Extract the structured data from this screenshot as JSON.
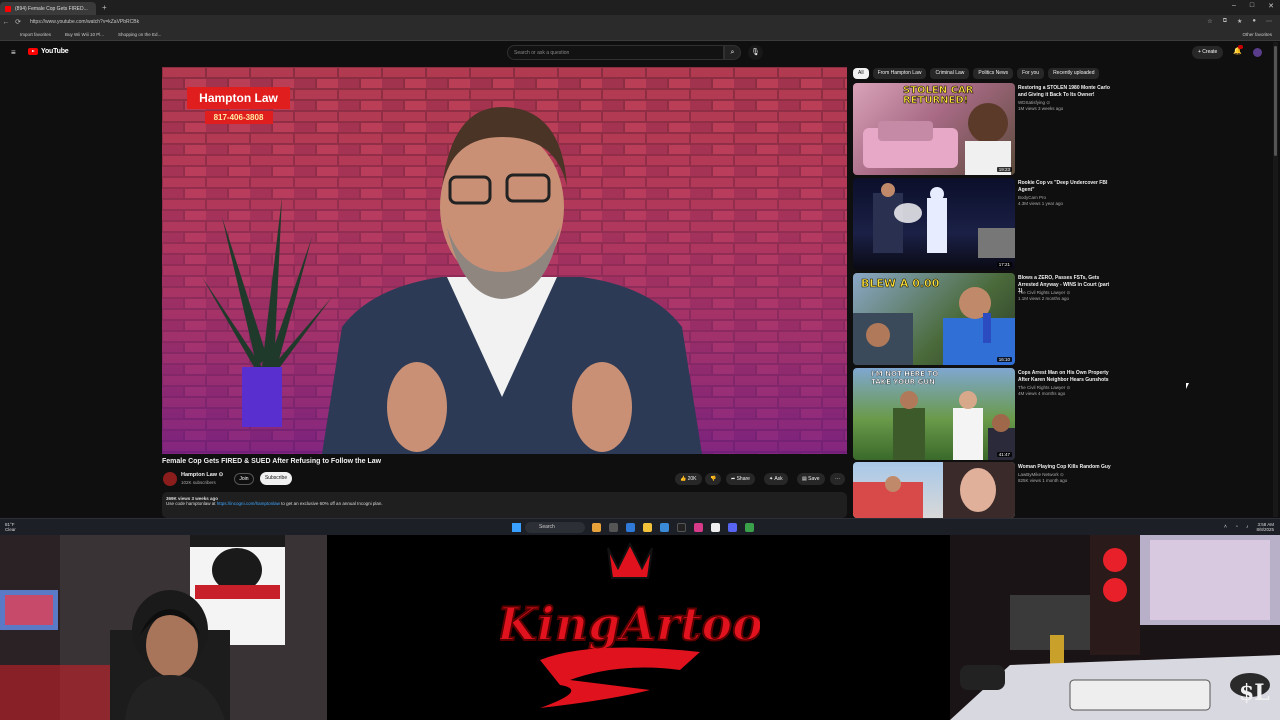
{
  "browser": {
    "tab_title": "(894) Female Cop Gets FIRED...",
    "new_tab": "+",
    "url": "https://www.youtube.com/watch?v=kZaVPbRCBk",
    "bookmarks": [
      "Import favorites",
      "Buy Wii Wiii 10 Pl...",
      "Shopping on the Ed..."
    ],
    "other_favorites": "Other favorites"
  },
  "youtube": {
    "logo_text": "YouTube",
    "search_placeholder": "Search or ask a question",
    "create_label": "+ Create"
  },
  "video": {
    "title": "Female Cop Gets FIRED & SUED After Refusing to Follow the Law",
    "overlay_name": "Hampton Law",
    "overlay_phone": "817-406-3808",
    "channel_name": "Hampton Law ⊙",
    "subscribers": "102K subscribers",
    "join_label": "Join",
    "subscribe_label": "Subscribe",
    "likes": "20K",
    "share_label": "Share",
    "ask_label": "Ask",
    "save_label": "Save",
    "more_label": "···",
    "views_line": "369K views  3 weeks ago",
    "desc_prefix": "Use code hamptonlaw at",
    "desc_link": "https://incogni.com/hamptonlaw",
    "desc_suffix": "to get an exclusive 60% off an annual Incogni plan."
  },
  "chips": [
    "All",
    "From Hampton Law",
    "Criminal Law",
    "Politics News",
    "For you",
    "Recently uploaded"
  ],
  "recommendations": [
    {
      "title": "Restoring a STOLEN 1980 Monte Carlo and Giving it Back To Its Owner!",
      "channel": "WDSatisfying ⊙",
      "meta": "1M views  3 weeks ago",
      "duration": "19:23",
      "thumb_text": "STOLEN CAR RETURNED!"
    },
    {
      "title": "Rookie Cop vs \"Deep Undercover FBI Agent\"",
      "channel": "BodyCam Pro",
      "meta": "4.3M views  1 year ago",
      "duration": "17:21",
      "thumb_text": ""
    },
    {
      "title": "Blows a ZERO, Passes FSTs, Gets Arrested Anyway - WINS in Court (part 1)",
      "channel": "The Civil Rights Lawyer ⊙",
      "meta": "1.1M views  2 months ago",
      "duration": "16:10",
      "thumb_text": "BLEW A 0.00"
    },
    {
      "title": "Cops Arrest Man on His Own Property After Karen Neighbor Hears Gunshots",
      "channel": "The Civil Rights Lawyer ⊙",
      "meta": "4M views  4 months ago",
      "duration": "41:47",
      "thumb_text": "I'M NOT HERE TO TAKE YOUR GUN"
    },
    {
      "title": "Woman Playing Cop Kills Random Guy",
      "channel": "LawByMike Network ⊙",
      "meta": "825K views  1 month ago",
      "duration": "",
      "thumb_text": ""
    }
  ],
  "taskbar": {
    "weather_temp": "81°F",
    "weather_desc": "Clear",
    "search_label": "Search",
    "time": "3:58 AM",
    "date": "8/8/2025"
  },
  "stream": {
    "logo_text": "KingArtoo",
    "signature": "$L"
  },
  "colors": {
    "yt_red": "#ff0000",
    "logo_red": "#e0121e",
    "link_blue": "#3ea6ff"
  }
}
